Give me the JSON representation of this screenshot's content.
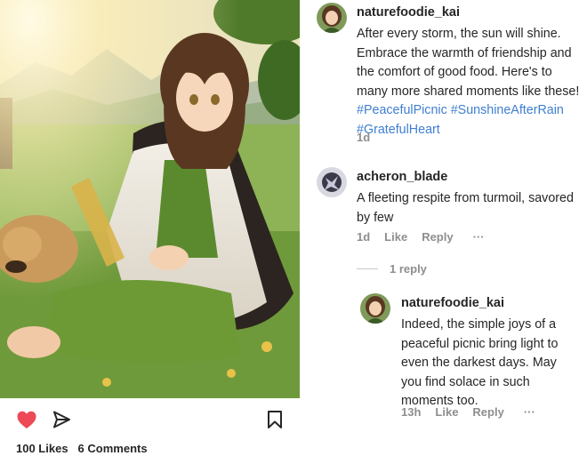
{
  "post": {
    "caption_author": "naturefoodie_kai",
    "caption_parts": [
      "After every storm, the sun will shine. Embrace the warmth of friendship and the comfort of good food. Here's to many more shared moments like these! ",
      "#PeacefulPicnic",
      " ",
      "#SunshineAfterRain",
      " ",
      "#GratefulHeart"
    ],
    "caption_time": "1d",
    "likes": "100 Likes",
    "comments_count": "6 Comments"
  },
  "comments": [
    {
      "username": "acheron_blade",
      "text": "A fleeting respite from turmoil, savored by few",
      "time": "1d",
      "like_label": "Like",
      "reply_label": "Reply",
      "more": "···",
      "replies_toggle": "1 reply",
      "replies": [
        {
          "username": "naturefoodie_kai",
          "text": "Indeed, the simple joys of a peaceful picnic bring light to even the darkest days. May you find solace in such moments too.",
          "time": "13h",
          "like_label": "Like",
          "reply_label": "Reply",
          "more": "···"
        }
      ]
    }
  ],
  "icons": {
    "like": "heart-icon",
    "share": "send-icon",
    "save": "bookmark-icon"
  },
  "colors": {
    "like_red": "#ed4956",
    "hashtag_blue": "#3f7fd0",
    "muted_gray": "#8e8e8e"
  }
}
